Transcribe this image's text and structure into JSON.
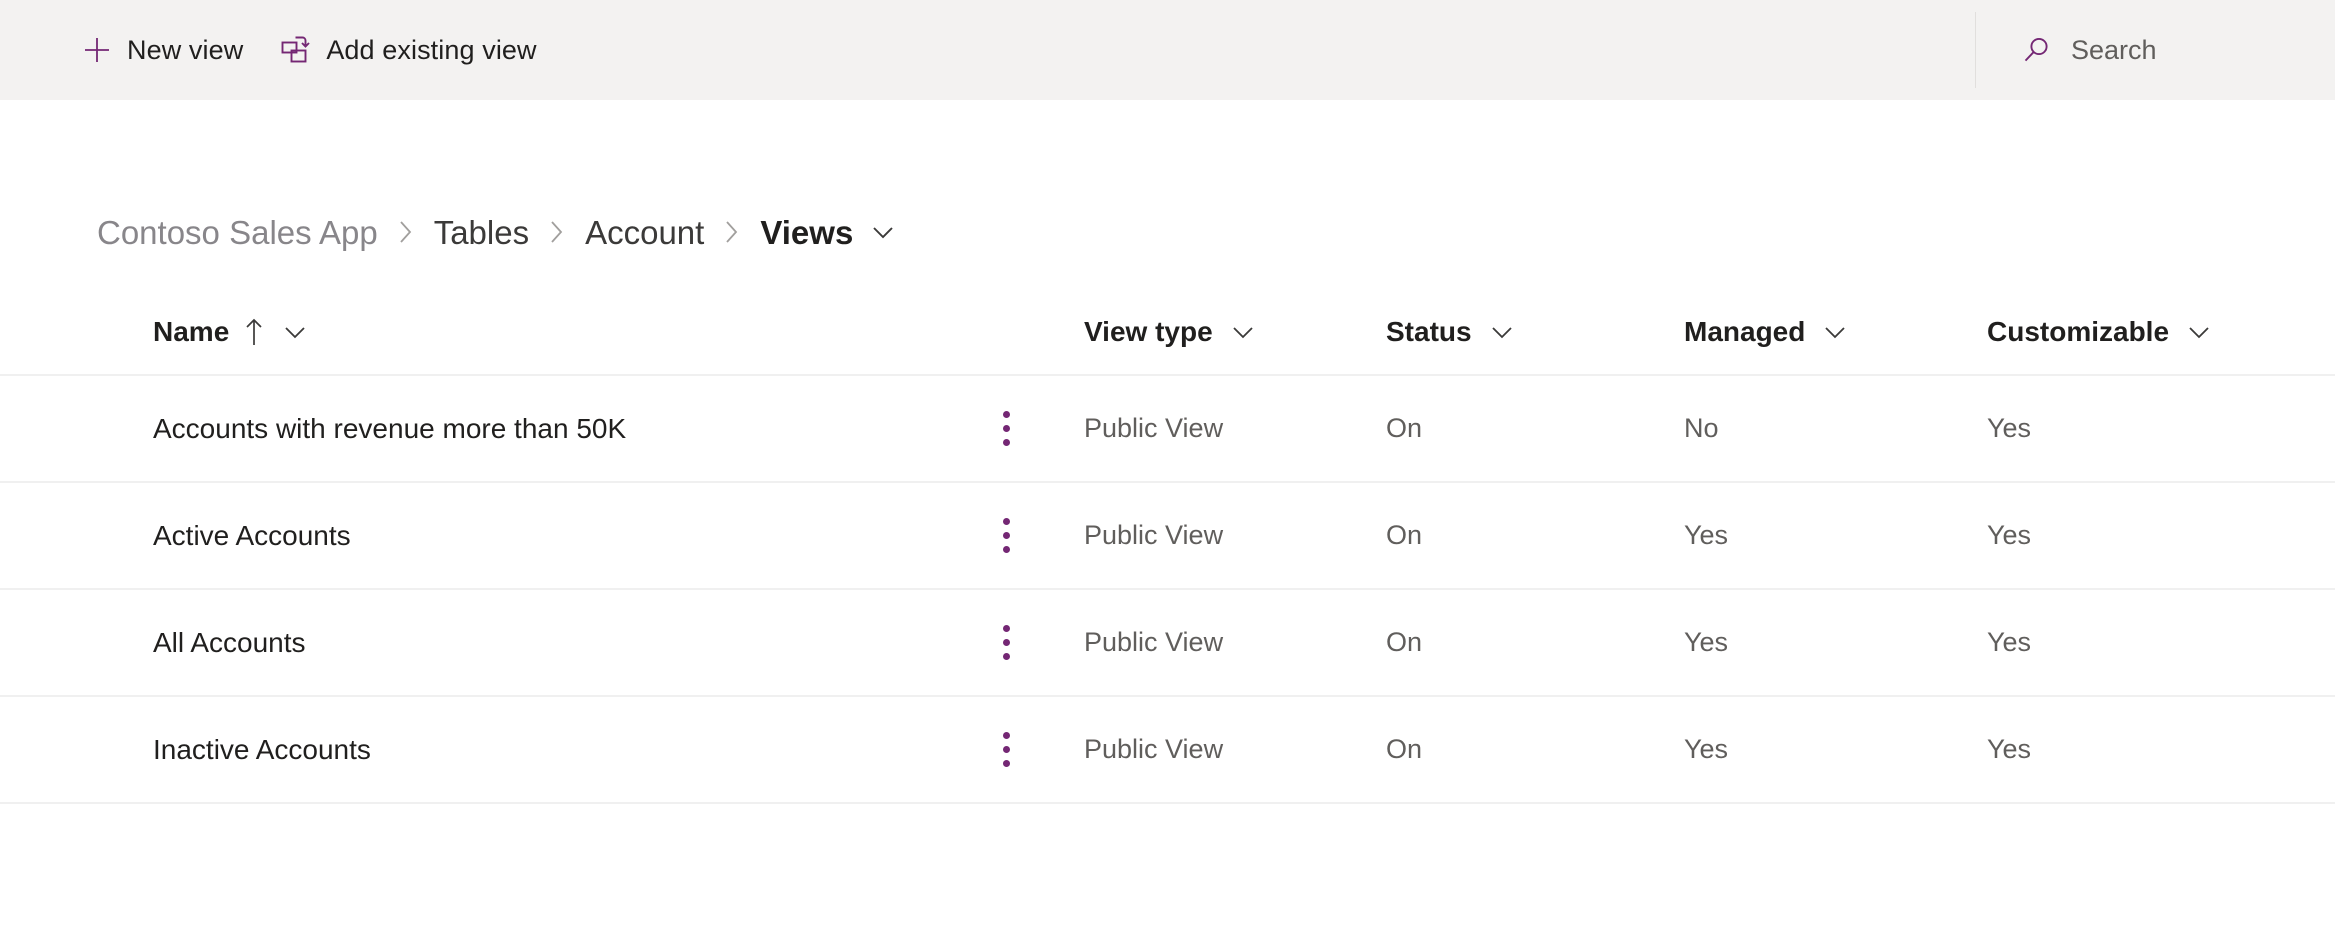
{
  "command_bar": {
    "buttons": [
      {
        "label": "New view",
        "icon": "plus-icon"
      },
      {
        "label": "Add existing view",
        "icon": "add-existing-view-icon"
      }
    ],
    "search": {
      "label": "Search",
      "icon": "search-icon"
    }
  },
  "breadcrumb": {
    "items": [
      {
        "label": "Contoso Sales App"
      },
      {
        "label": "Tables"
      },
      {
        "label": "Account"
      },
      {
        "label": "Views"
      }
    ],
    "separator": "›",
    "caret_icon": "chevron-down-icon"
  },
  "table": {
    "columns": [
      {
        "label": "Name",
        "sort": "ascending",
        "sort_icon": "arrow-up-icon",
        "caret_icon": "chevron-down-icon"
      },
      {
        "label": "View type",
        "caret_icon": "chevron-down-icon"
      },
      {
        "label": "Status",
        "caret_icon": "chevron-down-icon"
      },
      {
        "label": "Managed",
        "caret_icon": "chevron-down-icon"
      },
      {
        "label": "Customizable",
        "caret_icon": "chevron-down-icon"
      }
    ],
    "row_menu_icon": "more-vertical-icon",
    "rows": [
      {
        "name": "Accounts with revenue more than 50K",
        "view_type": "Public View",
        "status": "On",
        "managed": "No",
        "customizable": "Yes"
      },
      {
        "name": "Active Accounts",
        "view_type": "Public View",
        "status": "On",
        "managed": "Yes",
        "customizable": "Yes"
      },
      {
        "name": "All Accounts",
        "view_type": "Public View",
        "status": "On",
        "managed": "Yes",
        "customizable": "Yes"
      },
      {
        "name": "Inactive Accounts",
        "view_type": "Public View",
        "status": "On",
        "managed": "Yes",
        "customizable": "Yes"
      }
    ]
  },
  "colors": {
    "accent_purple": "#742774",
    "command_bar_bg": "#f3f2f1",
    "text_primary": "#201f1e",
    "text_secondary": "#605e5c",
    "row_divider": "#f0f0f0"
  }
}
